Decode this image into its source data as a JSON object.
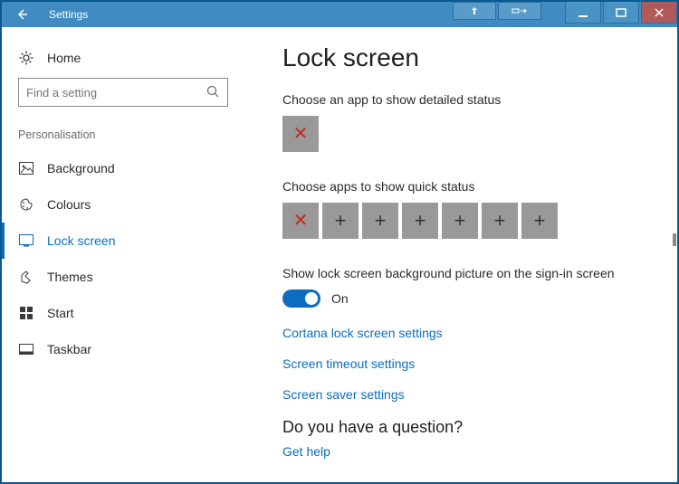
{
  "titlebar": {
    "title": "Settings"
  },
  "sidebar": {
    "home": "Home",
    "search_placeholder": "Find a setting",
    "category": "Personalisation",
    "items": [
      {
        "label": "Background"
      },
      {
        "label": "Colours"
      },
      {
        "label": "Lock screen"
      },
      {
        "label": "Themes"
      },
      {
        "label": "Start"
      },
      {
        "label": "Taskbar"
      }
    ]
  },
  "content": {
    "heading": "Lock screen",
    "detailed_label": "Choose an app to show detailed status",
    "quick_label": "Choose apps to show quick status",
    "toggle_label": "Show lock screen background picture on the sign-in screen",
    "toggle_state": "On",
    "links": {
      "cortana": "Cortana lock screen settings",
      "timeout": "Screen timeout settings",
      "saver": "Screen saver settings"
    },
    "question": "Do you have a question?",
    "help": "Get help"
  }
}
